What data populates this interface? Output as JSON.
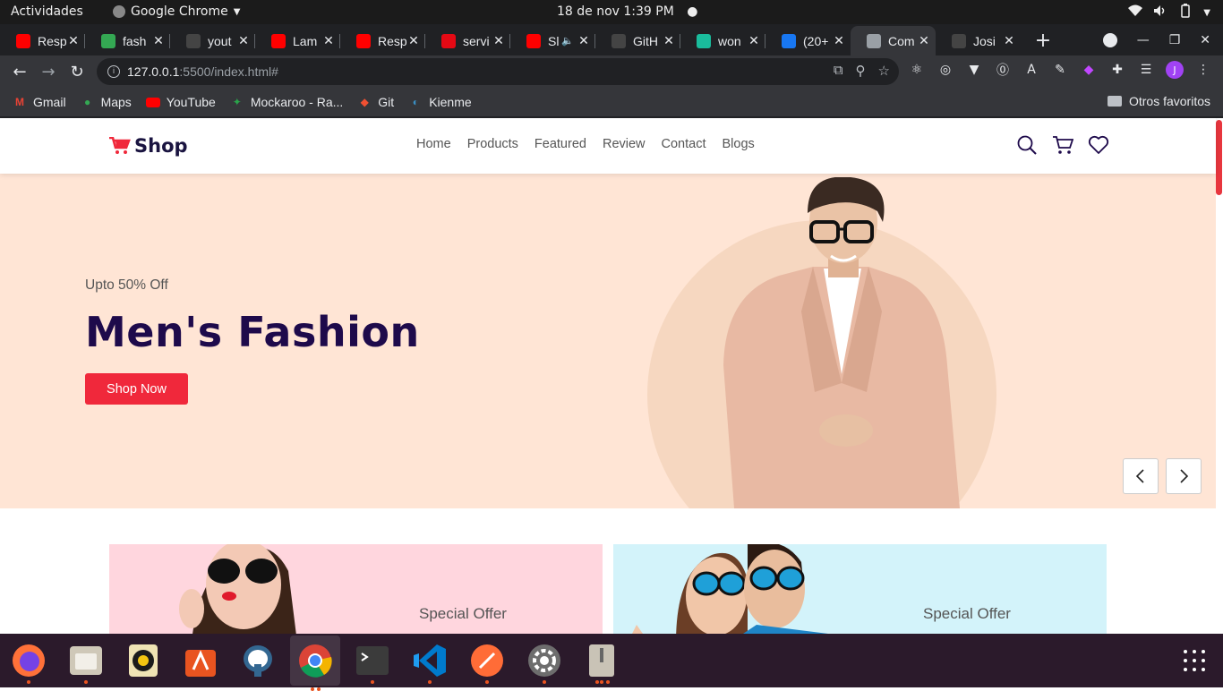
{
  "system": {
    "activities": "Actividades",
    "app_name": "Google Chrome",
    "clock": "18 de nov  1:39 PM"
  },
  "tabs": [
    {
      "title": "Resp",
      "favicon": "youtube-icon",
      "color": "#ff0000"
    },
    {
      "title": "fash",
      "favicon": "drive-icon",
      "color": "#34a853"
    },
    {
      "title": "yout",
      "favicon": "github-icon",
      "color": "#444"
    },
    {
      "title": "Lam",
      "favicon": "youtube-icon",
      "color": "#ff0000"
    },
    {
      "title": "Resp",
      "favicon": "youtube-icon",
      "color": "#ff0000"
    },
    {
      "title": "servi",
      "favicon": "brand-icon",
      "color": "#e50914"
    },
    {
      "title": "Sl",
      "favicon": "youtube-icon",
      "color": "#ff0000"
    },
    {
      "title": "GitH",
      "favicon": "github-icon",
      "color": "#444"
    },
    {
      "title": "won",
      "favicon": "diamond-icon",
      "color": "#1abc9c"
    },
    {
      "title": "(20+",
      "favicon": "facebook-icon",
      "color": "#1877f2"
    },
    {
      "title": "Com",
      "favicon": "globe-icon",
      "color": "#9aa0a6"
    },
    {
      "title": "Josi",
      "favicon": "github-icon",
      "color": "#444"
    }
  ],
  "address_bar": {
    "host": "127.0.0.1",
    "path": ":5500/index.html#"
  },
  "bookmarks": [
    {
      "label": "Gmail",
      "icon": "gmail-icon"
    },
    {
      "label": "Maps",
      "icon": "maps-icon"
    },
    {
      "label": "YouTube",
      "icon": "youtube-icon"
    },
    {
      "label": "Mockaroo - Ra...",
      "icon": "mockaroo-icon"
    },
    {
      "label": "Git",
      "icon": "git-icon"
    },
    {
      "label": "Kienme",
      "icon": "kienme-icon"
    }
  ],
  "other_bookmarks": "Otros favoritos",
  "profile_initial": "J",
  "site": {
    "brand": "Shop",
    "accent": "#f0283b",
    "brand_color": "#1e0a4b",
    "nav": [
      "Home",
      "Products",
      "Featured",
      "Review",
      "Contact",
      "Blogs"
    ],
    "hero": {
      "eyebrow": "Upto 50% Off",
      "title": "Men's Fashion",
      "cta": "Shop Now",
      "background": "#ffe5d5"
    },
    "promos": [
      {
        "label": "Special Offer",
        "background": "#ffd6de"
      },
      {
        "label": "Special Offer",
        "background": "#d3f3fa"
      }
    ]
  }
}
